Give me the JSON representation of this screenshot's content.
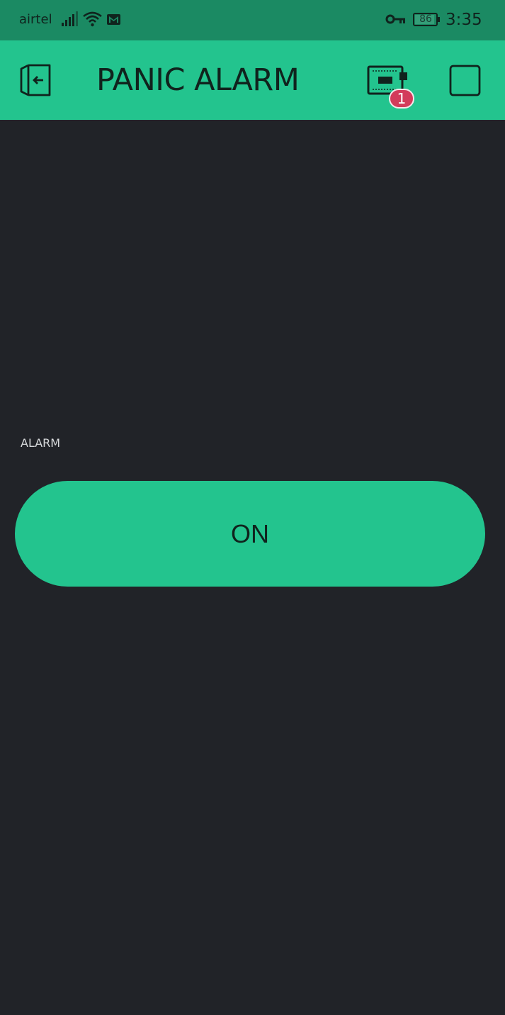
{
  "status_bar": {
    "carrier": "airtel",
    "battery_level": "86",
    "time": "3:35",
    "icons": [
      "signal-icon",
      "wifi-icon",
      "gmail-icon",
      "vpn-key-icon",
      "battery-icon"
    ]
  },
  "app_bar": {
    "title": "PANIC ALARM",
    "back_icon": "exit-icon",
    "device_icon": "device-icon",
    "device_badge": "1",
    "stop_icon": "stop-icon"
  },
  "widget": {
    "label": "ALARM",
    "button_label": "ON"
  },
  "colors": {
    "status_bar": "#1b8a63",
    "accent": "#23c48e",
    "background": "#212328",
    "badge": "#d33b5b",
    "text_dark": "#10231d",
    "text_light": "#d8dadc"
  }
}
